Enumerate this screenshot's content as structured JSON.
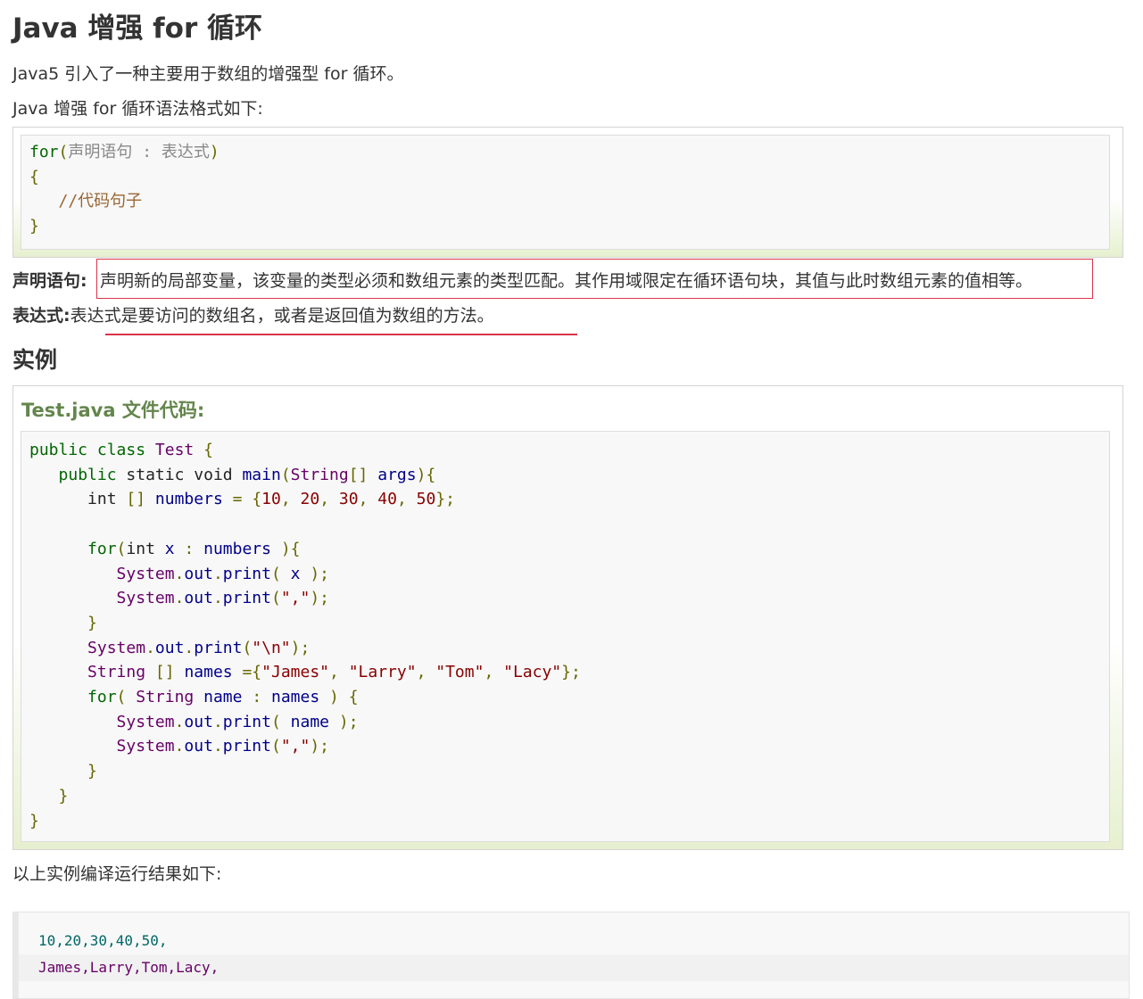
{
  "heading": "Java 增强 for 循环",
  "intro": "Java5 引入了一种主要用于数组的增强型 for 循环。",
  "syntax_intro": "Java 增强 for 循环语法格式如下:",
  "syntax_code": {
    "line1_kw": "for",
    "line1_open": "(",
    "line1_body": "声明语句 : 表达式",
    "line1_close": ")",
    "line2": "{",
    "line3": "   //代码句子",
    "line4": "}"
  },
  "definitions": [
    {
      "term": "声明语句:",
      "desc": "声明新的局部变量，该变量的类型必须和数组元素的类型匹配。其作用域限定在循环语句块，其值与此时数组元素的值相等。"
    },
    {
      "term": "表达式:",
      "desc": "表达式是要访问的数组名，或者是返回值为数组的方法。"
    }
  ],
  "example_heading": "实例",
  "example_file_title": "Test.java 文件代码:",
  "result_intro": "以上实例编译运行结果如下:",
  "output_lines": [
    "10,20,30,40,50,",
    "James,Larry,Tom,Lacy,"
  ],
  "colors": {
    "highlight_border": "#d9344a",
    "example_title": "#64854c",
    "keyword": "#006600",
    "string": "#880000",
    "number": "#006666"
  }
}
